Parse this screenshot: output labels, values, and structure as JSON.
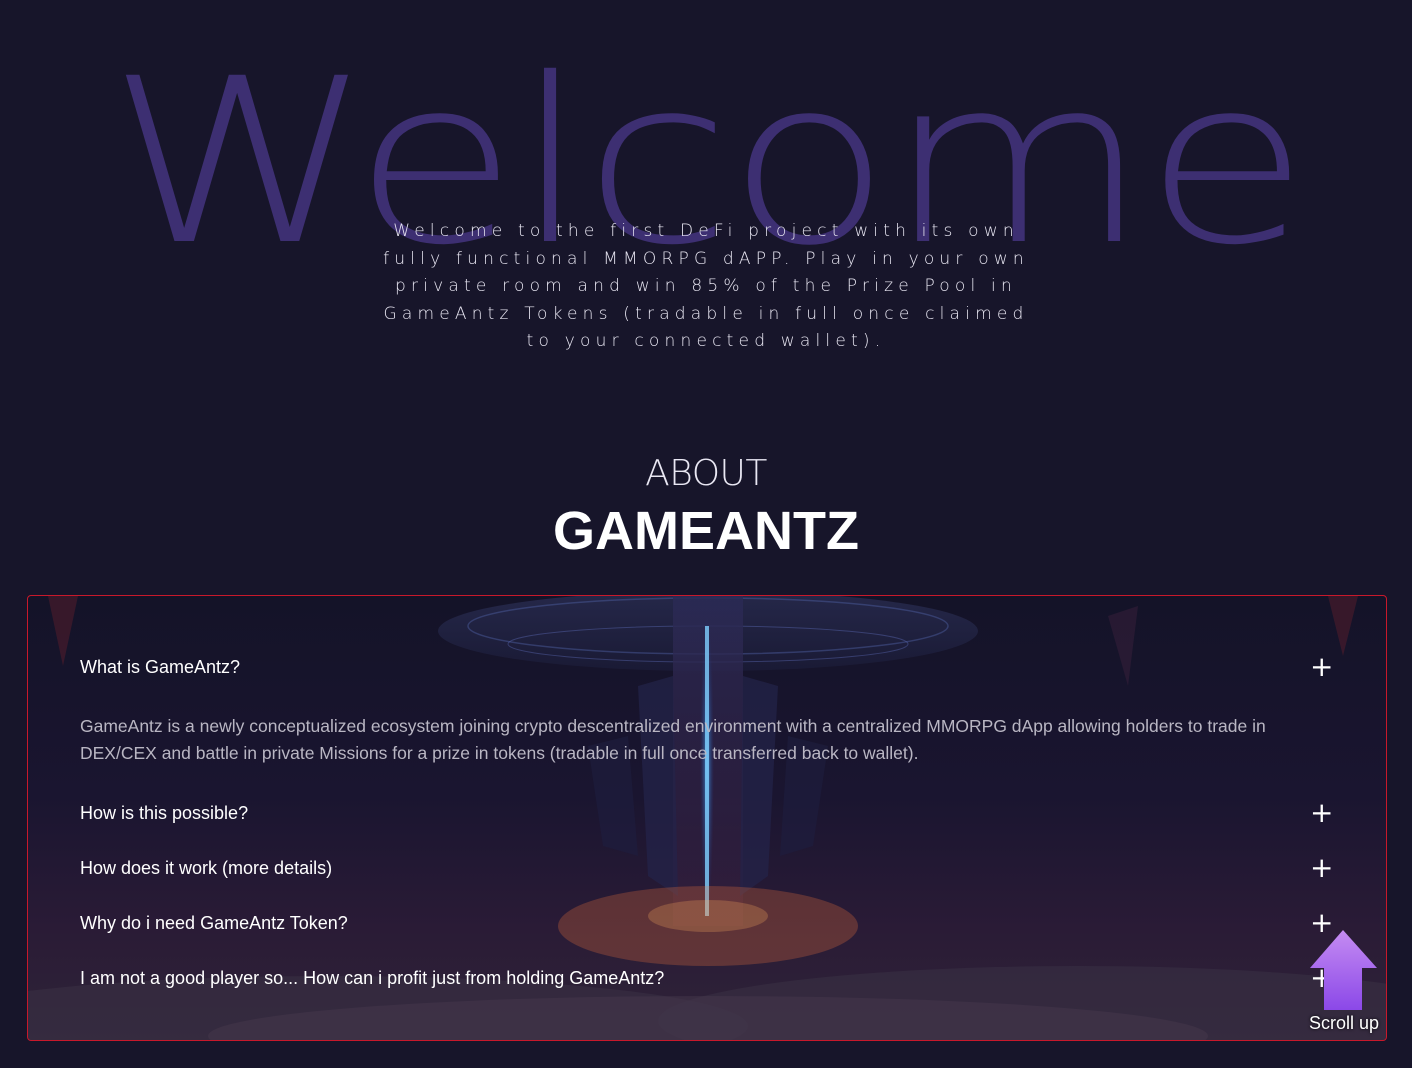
{
  "hero": {
    "watermark": "Welcome",
    "intro": "Welcome to the first DeFi project with its own fully functional MMORPG dAPP. Play in your own private room and win 85% of the Prize Pool in GameAntz Tokens (tradable in full once claimed to your connected wallet)."
  },
  "about": {
    "kicker": "ABOUT",
    "title": "GAMEANTZ"
  },
  "faq": {
    "items": [
      {
        "question": "What is GameAntz?",
        "toggle": "+",
        "expanded": true,
        "answer": "GameAntz is a newly conceptualized ecosystem joining crypto descentralized environment with a centralized MMORPG dApp allowing holders to trade in DEX/CEX and battle in private Missions for a prize in tokens (tradable in full once transferred back to wallet)."
      },
      {
        "question": "How is this possible?",
        "toggle": "+",
        "expanded": false
      },
      {
        "question": "How does it work (more details)",
        "toggle": "+",
        "expanded": false
      },
      {
        "question": "Why do i need GameAntz Token?",
        "toggle": "+",
        "expanded": false
      },
      {
        "question": "I am not a good player so... How can i profit just from holding GameAntz?",
        "toggle": "+",
        "expanded": false
      }
    ]
  },
  "scroll_up": {
    "label": "Scroll up",
    "icon": "up-arrow-icon"
  },
  "colors": {
    "background": "#17152a",
    "watermark": "#3d2f72",
    "panel_border": "#c8182b",
    "scroll_arrow_top": "#c58cf2",
    "scroll_arrow_bottom": "#8b48e8"
  }
}
